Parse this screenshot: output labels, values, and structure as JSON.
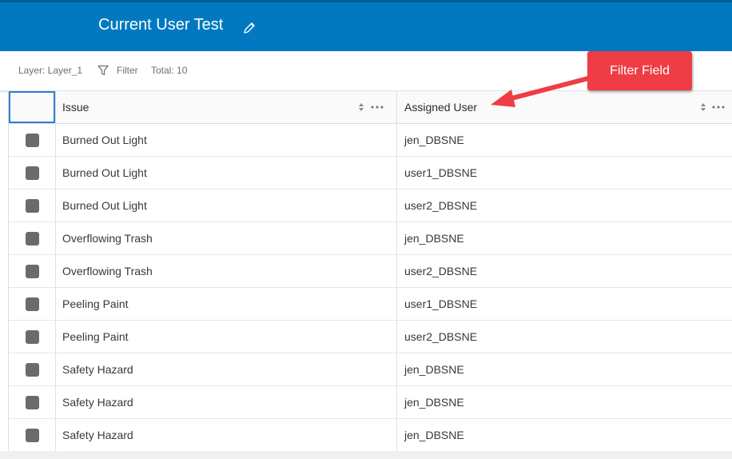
{
  "header": {
    "title": "Current User Test",
    "edit_icon": "pencil-icon",
    "background": "#0079c1"
  },
  "toolbar": {
    "layer_label": "Layer: Layer_1",
    "filter_label": "Filter",
    "total_label": "Total: 10",
    "filter_icon": "funnel-icon"
  },
  "table": {
    "columns": [
      {
        "label": "Issue"
      },
      {
        "label": "Assigned User"
      }
    ],
    "rows": [
      {
        "issue": "Burned Out Light",
        "user": "jen_DBSNE"
      },
      {
        "issue": "Burned Out Light",
        "user": "user1_DBSNE"
      },
      {
        "issue": "Burned Out Light",
        "user": "user2_DBSNE"
      },
      {
        "issue": "Overflowing Trash",
        "user": "jen_DBSNE"
      },
      {
        "issue": "Overflowing Trash",
        "user": "user2_DBSNE"
      },
      {
        "issue": "Peeling Paint",
        "user": "user1_DBSNE"
      },
      {
        "issue": "Peeling Paint",
        "user": "user2_DBSNE"
      },
      {
        "issue": "Safety Hazard",
        "user": "jen_DBSNE"
      },
      {
        "issue": "Safety Hazard",
        "user": "jen_DBSNE"
      },
      {
        "issue": "Safety Hazard",
        "user": "jen_DBSNE"
      }
    ]
  },
  "annotation": {
    "label": "Filter Field",
    "color": "#ef3d45"
  }
}
